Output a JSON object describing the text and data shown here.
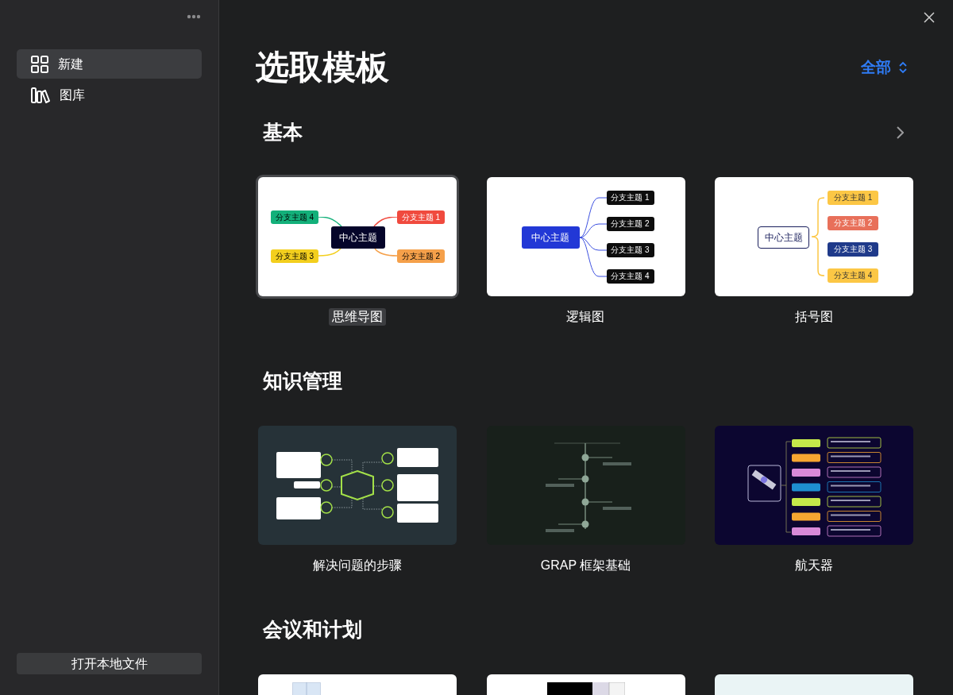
{
  "sidebar": {
    "items": [
      {
        "label": "新建",
        "selected": true
      },
      {
        "label": "图库",
        "selected": false
      }
    ],
    "open_button": "打开本地文件"
  },
  "title": "选取模板",
  "filter": {
    "label": "全部"
  },
  "sections": [
    {
      "title": "基本",
      "has_more": true,
      "templates": [
        {
          "kind": "mindmap",
          "label": "思维导图",
          "selected": true,
          "preview": {
            "center": "中心主题",
            "branches": [
              {
                "label": "分支主题 4",
                "color": "#13b07a"
              },
              {
                "label": "分支主题 1",
                "color": "#f04a3e"
              },
              {
                "label": "分支主题 3",
                "color": "#f3cf1e"
              },
              {
                "label": "分支主题 2",
                "color": "#f5a04a"
              }
            ]
          }
        },
        {
          "kind": "logic",
          "label": "逻辑图",
          "selected": false,
          "preview": {
            "center": "中心主题",
            "branches": [
              {
                "label": "分支主题 1"
              },
              {
                "label": "分支主题 2"
              },
              {
                "label": "分支主题 3"
              },
              {
                "label": "分支主题 4"
              }
            ]
          }
        },
        {
          "kind": "brace",
          "label": "括号图",
          "selected": false,
          "preview": {
            "center": "中心主题",
            "branches": [
              {
                "label": "分支主题 1",
                "color": "#fcc745"
              },
              {
                "label": "分支主题 2",
                "color": "#e8705a"
              },
              {
                "label": "分支主题 3",
                "color": "#1f3a8a"
              },
              {
                "label": "分支主题 4",
                "color": "#fcc745"
              }
            ]
          }
        }
      ]
    },
    {
      "title": "知识管理",
      "has_more": false,
      "templates": [
        {
          "kind": "problem",
          "label": "解决问题的步骤",
          "selected": false
        },
        {
          "kind": "timeline",
          "label": "GRAP 框架基础",
          "selected": false
        },
        {
          "kind": "spacecraft",
          "label": "航天器",
          "selected": false
        }
      ]
    },
    {
      "title": "会议和计划",
      "has_more": false,
      "templates": [
        {
          "kind": "sheet"
        },
        {
          "kind": "table"
        },
        {
          "kind": "plain"
        }
      ]
    }
  ]
}
